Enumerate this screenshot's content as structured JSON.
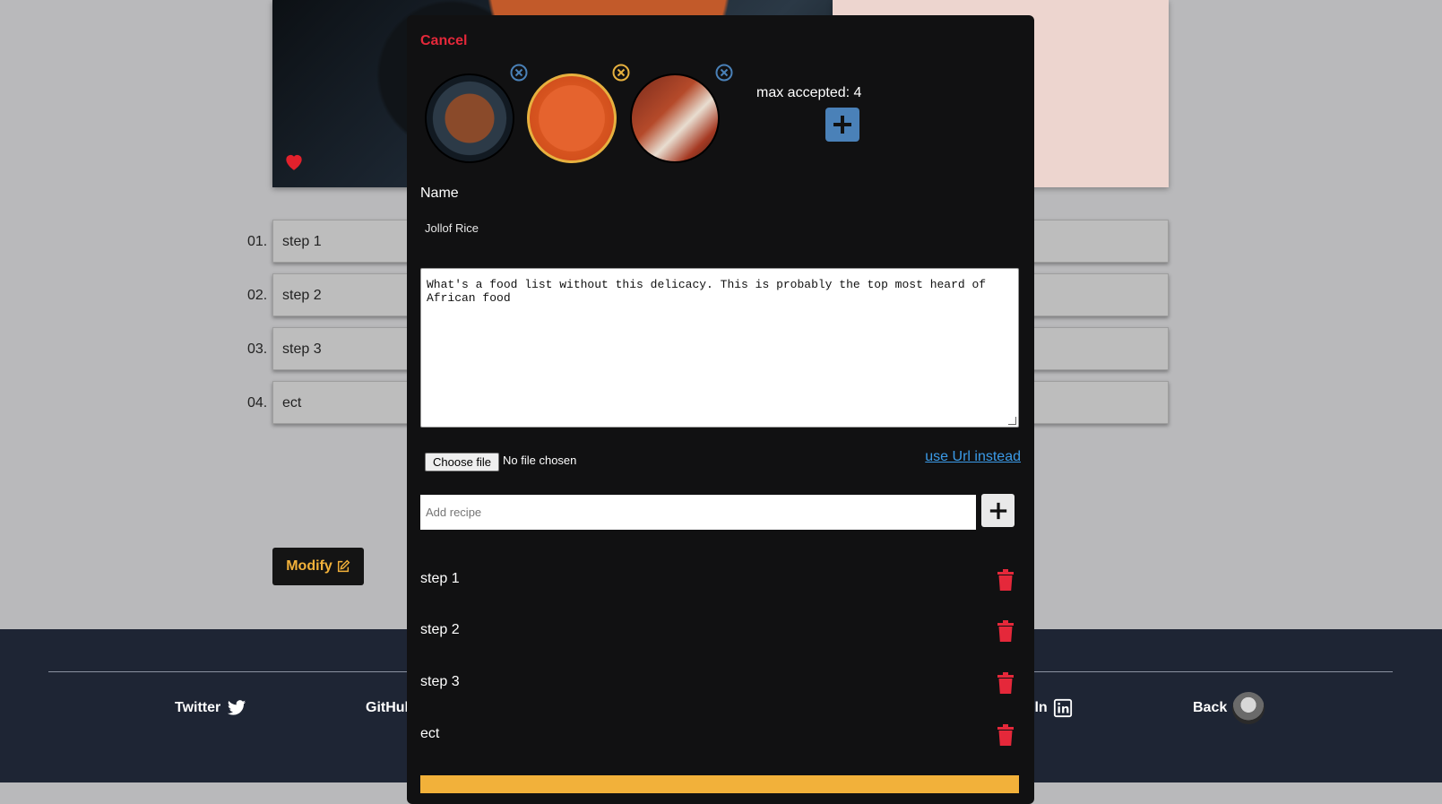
{
  "background": {
    "steps": [
      {
        "num": "01.",
        "text": "step 1"
      },
      {
        "num": "02.",
        "text": "step 2"
      },
      {
        "num": "03.",
        "text": "step 3"
      },
      {
        "num": "04.",
        "text": "ect"
      }
    ],
    "modify_label": "Modify",
    "footer": {
      "twitter": "Twitter",
      "github": "GitHul",
      "linkedin": "lln",
      "back": "Back"
    }
  },
  "modal": {
    "cancel_label": "Cancel",
    "max_accepted": "max accepted: 4",
    "name_label": "Name",
    "name_value": "Jollof Rice",
    "description": "What's a food list without this delicacy. This is probably the top most heard of African food",
    "file_button": "Choose file",
    "file_status": "No file chosen",
    "url_link": "use Url instead",
    "recipe_placeholder": "Add recipe",
    "recipe_steps": [
      "step 1",
      "step 2",
      "step 3",
      "ect"
    ]
  },
  "colors": {
    "accent_gold": "#f2b13a",
    "danger_red": "#e5283a",
    "info_blue": "#4a81b8",
    "footer_bg": "#1e2534",
    "modal_bg": "#111112"
  }
}
